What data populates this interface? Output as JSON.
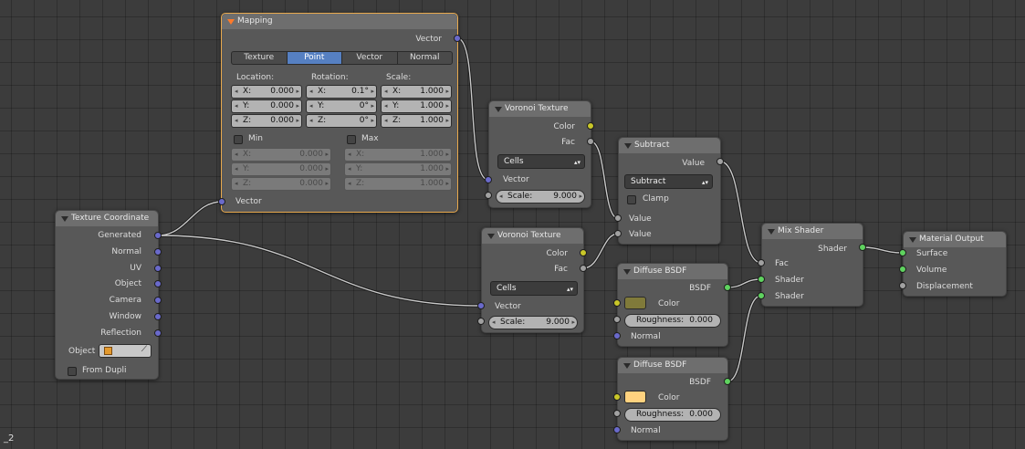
{
  "corner_label": "_2",
  "colors": {
    "vector_socket": "#6a6acb",
    "color_socket": "#c9c729",
    "value_socket": "#a1a1a1",
    "shader_socket": "#5fd35f",
    "selected_outline": "#e8a94d",
    "active_button": "#5680c2",
    "diffuse1_color": "#807a3a",
    "diffuse2_color": "#ffd27f"
  },
  "texcoord": {
    "title": "Texture Coordinate",
    "outputs": [
      "Generated",
      "Normal",
      "UV",
      "Object",
      "Camera",
      "Window",
      "Reflection"
    ],
    "object_label": "Object",
    "object_icon": "cube-icon",
    "eyedropper_icon": "eyedropper-icon",
    "from_dupli": "From Dupli"
  },
  "mapping": {
    "title": "Mapping",
    "output": "Vector",
    "tabs": [
      "Texture",
      "Point",
      "Vector",
      "Normal"
    ],
    "active_tab": "Point",
    "location_label": "Location:",
    "rotation_label": "Rotation:",
    "scale_label": "Scale:",
    "location": [
      {
        "axis": "X:",
        "value": "0.000"
      },
      {
        "axis": "Y:",
        "value": "0.000"
      },
      {
        "axis": "Z:",
        "value": "0.000"
      }
    ],
    "rotation": [
      {
        "axis": "X:",
        "value": "0.1°"
      },
      {
        "axis": "Y:",
        "value": "0°"
      },
      {
        "axis": "Z:",
        "value": "0°"
      }
    ],
    "scale": [
      {
        "axis": "X:",
        "value": "1.000"
      },
      {
        "axis": "Y:",
        "value": "1.000"
      },
      {
        "axis": "Z:",
        "value": "1.000"
      }
    ],
    "min_label": "Min",
    "max_label": "Max",
    "min": [
      {
        "axis": "X:",
        "value": "0.000"
      },
      {
        "axis": "Y:",
        "value": "0.000"
      },
      {
        "axis": "Z:",
        "value": "0.000"
      }
    ],
    "max": [
      {
        "axis": "X:",
        "value": "1.000"
      },
      {
        "axis": "Y:",
        "value": "1.000"
      },
      {
        "axis": "Z:",
        "value": "1.000"
      }
    ],
    "input": "Vector"
  },
  "voronoi1": {
    "title": "Voronoi Texture",
    "out_color": "Color",
    "out_fac": "Fac",
    "mode": "Cells",
    "in_vector": "Vector",
    "scale_label": "Scale:",
    "scale_value": "9.000"
  },
  "voronoi2": {
    "title": "Voronoi Texture",
    "out_color": "Color",
    "out_fac": "Fac",
    "mode": "Cells",
    "in_vector": "Vector",
    "scale_label": "Scale:",
    "scale_value": "9.000"
  },
  "subtract": {
    "title": "Subtract",
    "out_value": "Value",
    "operation": "Subtract",
    "clamp": "Clamp",
    "in1": "Value",
    "in2": "Value"
  },
  "diffuse1": {
    "title": "Diffuse BSDF",
    "out": "BSDF",
    "color_label": "Color",
    "roughness_label": "Roughness:",
    "roughness_value": "0.000",
    "normal_label": "Normal"
  },
  "diffuse2": {
    "title": "Diffuse BSDF",
    "out": "BSDF",
    "color_label": "Color",
    "roughness_label": "Roughness:",
    "roughness_value": "0.000",
    "normal_label": "Normal"
  },
  "mix": {
    "title": "Mix Shader",
    "out": "Shader",
    "fac": "Fac",
    "shader1": "Shader",
    "shader2": "Shader"
  },
  "output": {
    "title": "Material Output",
    "surface": "Surface",
    "volume": "Volume",
    "displacement": "Displacement"
  }
}
